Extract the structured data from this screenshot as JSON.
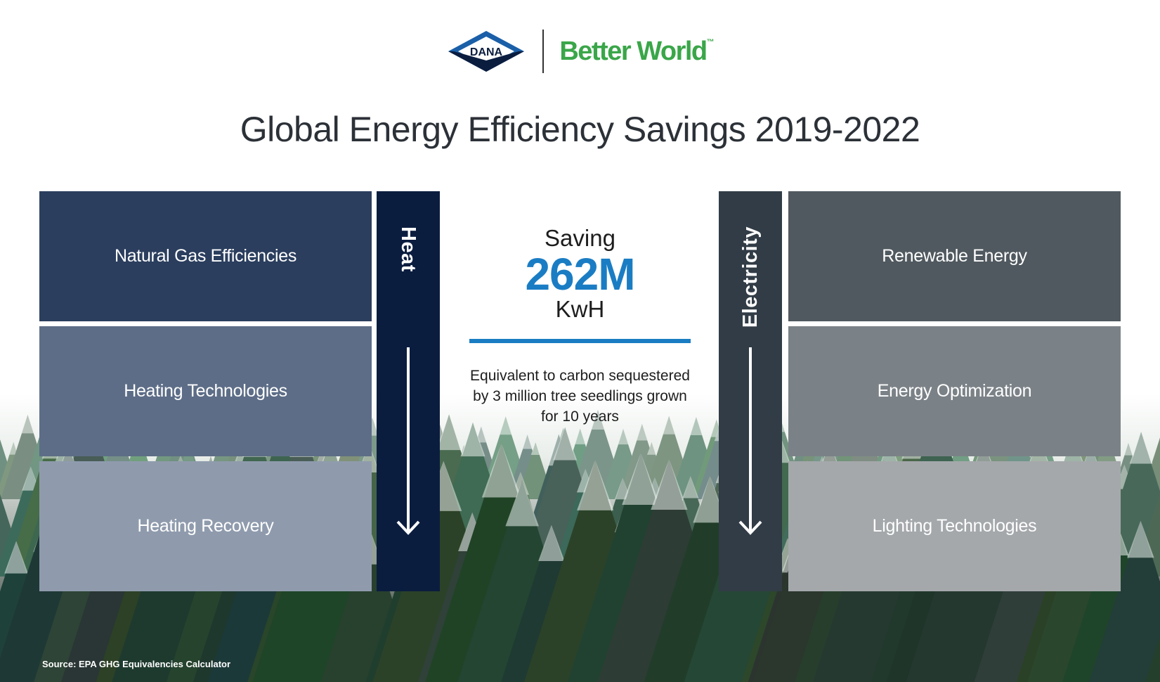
{
  "brand": {
    "logo_text": "DANA",
    "tagline": "Better World",
    "tagline_mark": "™",
    "colors": {
      "tagline": "#3aa649",
      "logo_blue": "#1a5fa8",
      "logo_dark": "#0b1d3f"
    }
  },
  "title": "Global Energy Efficiency Savings 2019-2022",
  "heat": {
    "label": "Heat",
    "items": [
      "Natural Gas Efficiencies",
      "Heating Technologies",
      "Heating Recovery"
    ],
    "colors": [
      "#2b3e5e",
      "#5d6d87",
      "#8f9bad"
    ],
    "bar_color": "#0b1d3f"
  },
  "electricity": {
    "label": "Electricity",
    "items": [
      "Renewable Energy",
      "Energy Optimization",
      "Lighting Technologies"
    ],
    "colors": [
      "#50595f",
      "#7b8287",
      "#a4a8ab"
    ],
    "bar_color": "#313c46"
  },
  "summary": {
    "saving_label": "Saving",
    "saving_value": "262M",
    "saving_unit": "KwH",
    "equivalent_text": "Equivalent to carbon sequestered by 3 million tree seedlings grown for 10 years",
    "accent_color": "#1a7dc4"
  },
  "source": "Source: EPA GHG Equivalencies Calculator"
}
